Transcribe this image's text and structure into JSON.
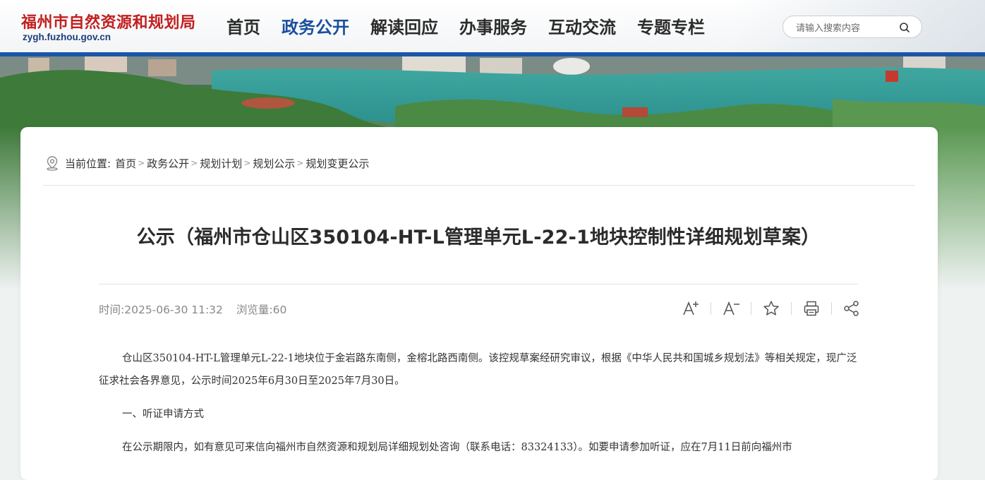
{
  "header": {
    "site_title": "福州市自然资源和规划局",
    "site_url": "zygh.fuzhou.gov.cn"
  },
  "nav": {
    "items": [
      {
        "label": "首页",
        "active": false
      },
      {
        "label": "政务公开",
        "active": true
      },
      {
        "label": "解读回应",
        "active": false
      },
      {
        "label": "办事服务",
        "active": false
      },
      {
        "label": "互动交流",
        "active": false
      },
      {
        "label": "专题专栏",
        "active": false
      }
    ]
  },
  "search": {
    "placeholder": "请输入搜索内容"
  },
  "breadcrumb": {
    "prefix": "当前位置:",
    "items": [
      "首页",
      "政务公开",
      "规划计划",
      "规划公示",
      "规划变更公示"
    ],
    "separator": ">"
  },
  "article": {
    "title": "公示（福州市仓山区350104-HT-L管理单元L-22-1地块控制性详细规划草案）",
    "time_label": "时间:",
    "time_value": "2025-06-30 11:32",
    "views_label": "浏览量:",
    "views_value": "60",
    "paragraph1": "仓山区350104-HT-L管理单元L-22-1地块位于金岩路东南侧，金榕北路西南侧。该控规草案经研究审议，根据《中华人民共和国城乡规划法》等相关规定，现广泛征求社会各界意见，公示时间2025年6月30日至2025年7月30日。",
    "section1": "一、听证申请方式",
    "paragraph2": "在公示期限内，如有意见可来信向福州市自然资源和规划局详细规划处咨询（联系电话：83324133）。如要申请参加听证，应在7月11日前向福州市"
  },
  "tools": [
    "font-increase-icon",
    "font-decrease-icon",
    "star-icon",
    "print-icon",
    "share-icon"
  ],
  "colors": {
    "brand_red": "#c21f1f",
    "nav_active": "#1b4f9c",
    "header_line": "#1b55a8"
  }
}
